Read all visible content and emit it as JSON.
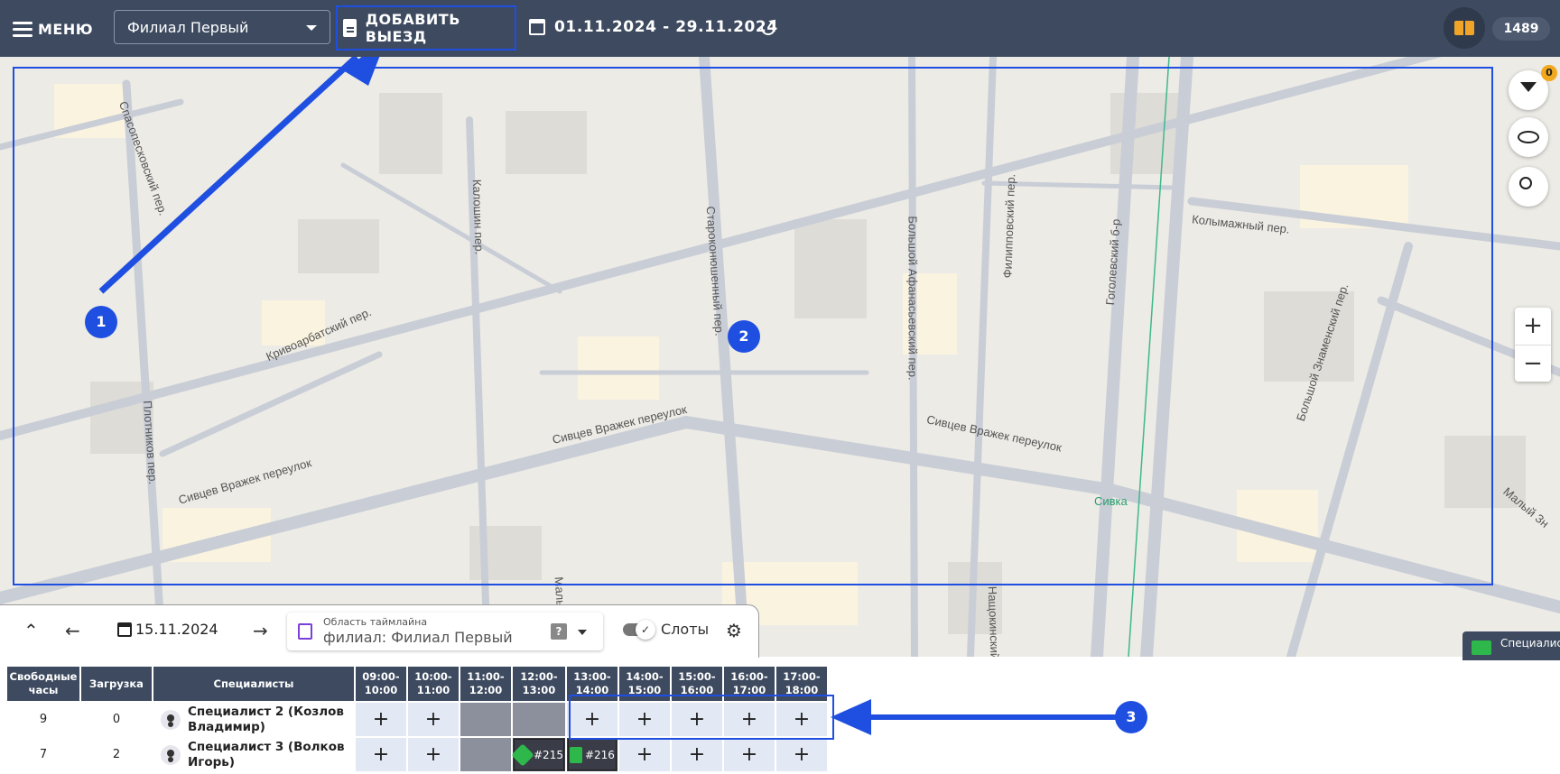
{
  "header": {
    "menu_label": "МЕНЮ",
    "branch": "Филиал Первый",
    "add_trip_label": "ДОБАВИТЬ ВЫЕЗД",
    "date_range": "01.11.2024 - 29.11.2024",
    "counter": "1489"
  },
  "map": {
    "filter_badge": "0",
    "zoom_in": "+",
    "zoom_out": "−",
    "specialist_chip": "Специалист",
    "streets": [
      "Спасопесковский пер.",
      "Калошин пер.",
      "Староконюшенный пер.",
      "Большой Афанасьевский пер.",
      "Филипповский пер.",
      "Гоголевский б-р",
      "Колымажный пер.",
      "Кривоарбатский пер.",
      "Сивцев Вражек переулок",
      "Плотников пер.",
      "Малый Вл",
      "Нащокинский",
      "Большой Знаменский пер.",
      "Сивка",
      "Малый Зн"
    ]
  },
  "annotations": {
    "m1": "1",
    "m2": "2",
    "m3": "3"
  },
  "timeline": {
    "date": "15.11.2024",
    "area_label": "Область таймлайна",
    "area_kind": "филиал:",
    "area_value": "Филиал Первый",
    "help": "?",
    "slots_label": "Слоты"
  },
  "table": {
    "headers": [
      "Свободные часы",
      "Загрузка",
      "Специалисты",
      "09:00-10:00",
      "10:00-11:00",
      "11:00-12:00",
      "12:00-13:00",
      "13:00-14:00",
      "14:00-15:00",
      "15:00-16:00",
      "16:00-17:00",
      "17:00-18:00"
    ],
    "rows": [
      {
        "free": "9",
        "load": "0",
        "name": "Специалист 2 (Козлов Владимир)",
        "slots": [
          "+",
          "+",
          "",
          "",
          "+",
          "+",
          "+",
          "+",
          "+"
        ]
      },
      {
        "free": "7",
        "load": "2",
        "name": "Специалист 3 (Волков Игорь)",
        "slots": [
          "+",
          "+",
          "",
          "#215",
          "#216",
          "+",
          "+",
          "+",
          "+"
        ]
      }
    ]
  },
  "colors": {
    "topbar": "#3d4a5f",
    "accent": "#1f4fe0",
    "badge": "#f2a81d",
    "job_icon": "#2eb84c"
  }
}
